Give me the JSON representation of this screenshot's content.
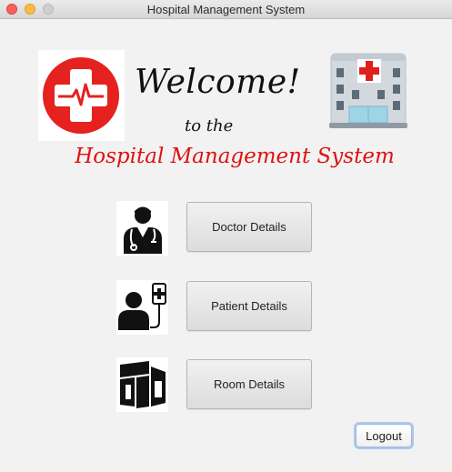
{
  "window": {
    "title": "Hospital Management System"
  },
  "header": {
    "welcome": "Welcome!",
    "to_the": "to the",
    "title": "Hospital Management System"
  },
  "menu": {
    "doctor_label": "Doctor Details",
    "patient_label": "Patient Details",
    "room_label": "Room Details"
  },
  "footer": {
    "logout_label": "Logout"
  },
  "icons": {
    "logo": "medical-cross-heartbeat-icon",
    "hospital": "hospital-building-icon",
    "doctor": "doctor-icon",
    "patient": "patient-iv-icon",
    "room": "room-icon"
  },
  "colors": {
    "accent_red": "#e01010",
    "logo_red": "#e5221f",
    "focus_blue": "#a9c9f2"
  }
}
